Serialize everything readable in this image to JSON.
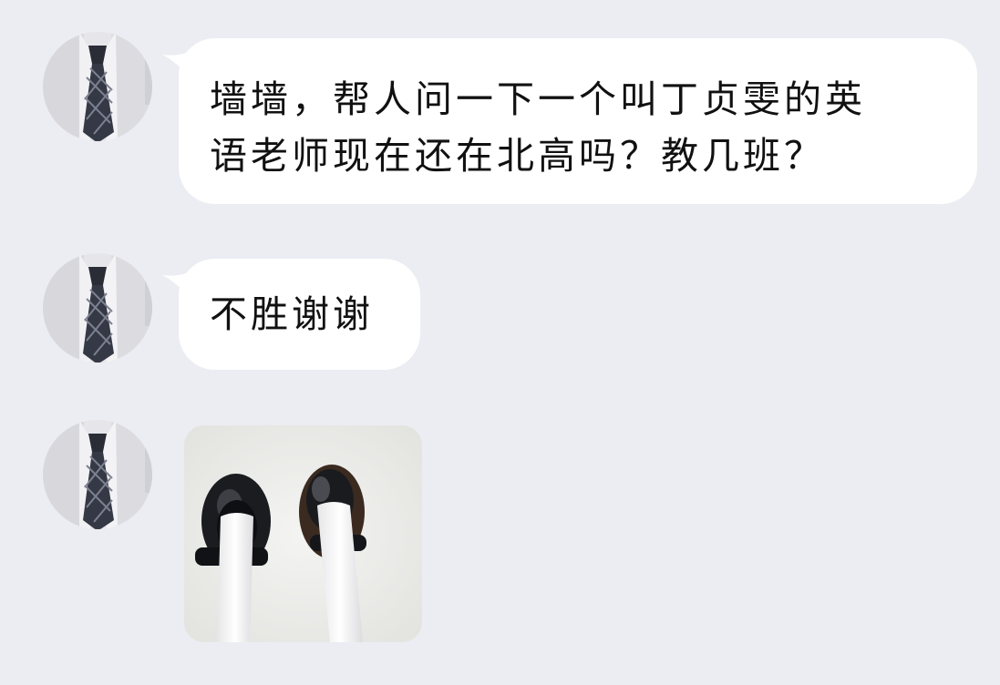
{
  "chat": {
    "messages": [
      {
        "sender_avatar": "avatar-tie-shirt",
        "lines": [
          "墙墙，帮人问一下一个叫丁贞雯的英",
          "语老师现在还在北高吗？教几班？"
        ]
      },
      {
        "sender_avatar": "avatar-tie-shirt",
        "text": "不胜谢谢"
      },
      {
        "sender_avatar": "avatar-tie-shirt",
        "image": "photo-black-mary-jane-shoes"
      }
    ]
  },
  "colors": {
    "background": "#ecedf2",
    "bubble": "#ffffff",
    "text": "#111111"
  }
}
